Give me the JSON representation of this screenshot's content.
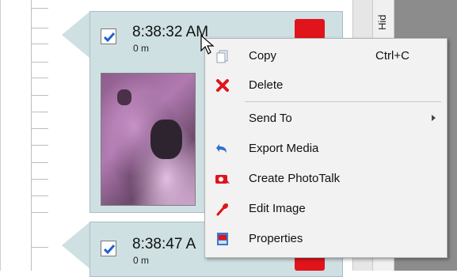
{
  "timeline": {
    "tick_count": 14
  },
  "cards": [
    {
      "time": "8:38:32 AM",
      "distance": "0 m",
      "checked": true
    },
    {
      "time": "8:38:47 A",
      "distance": "0 m",
      "checked": true
    }
  ],
  "right_tab": {
    "label": "Hid"
  },
  "context_menu": {
    "items": [
      {
        "label": "Copy",
        "shortcut": "Ctrl+C",
        "icon": "copy-icon"
      },
      {
        "label": "Delete",
        "shortcut": "",
        "icon": "delete-x-icon"
      },
      {
        "label": "Send To",
        "shortcut": "",
        "icon": "",
        "submenu": true
      },
      {
        "label": "Export Media",
        "shortcut": "",
        "icon": "export-arrow-icon"
      },
      {
        "label": "Create PhotoTalk",
        "shortcut": "",
        "icon": "phototalk-icon"
      },
      {
        "label": "Edit Image",
        "shortcut": "",
        "icon": "edit-brush-icon"
      },
      {
        "label": "Properties",
        "shortcut": "",
        "icon": "properties-icon"
      }
    ]
  },
  "colors": {
    "card_bg": "#cfe0e3",
    "accent_red": "#e0141b",
    "check_blue": "#1e62c9",
    "menu_bg": "#f2f2f2"
  }
}
